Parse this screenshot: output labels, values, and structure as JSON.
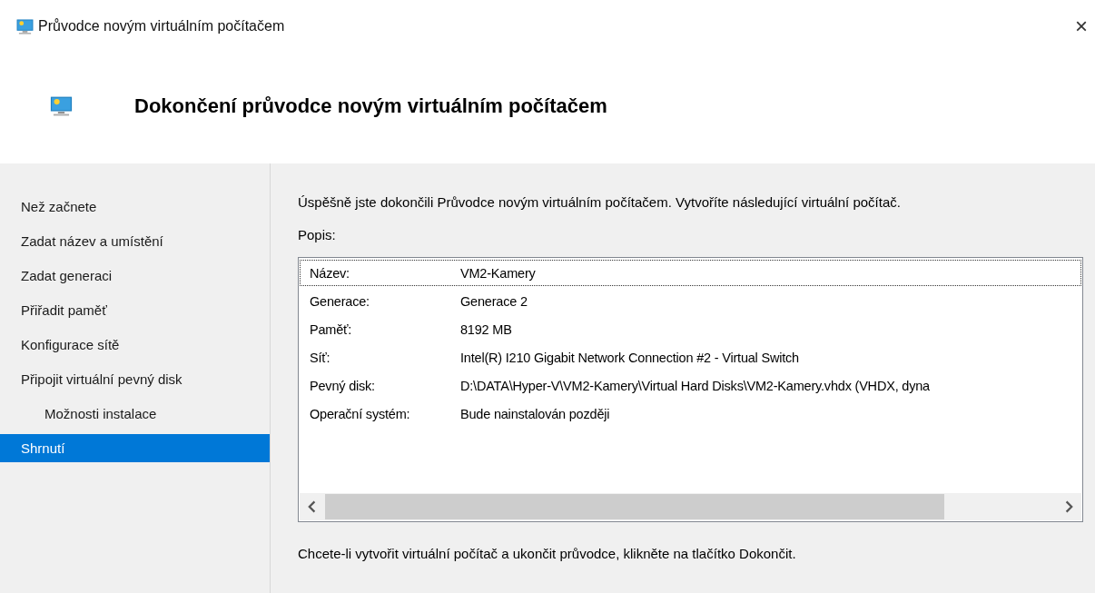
{
  "window": {
    "title": "Průvodce novým virtuálním počítačem",
    "close": "×"
  },
  "header": {
    "title": "Dokončení průvodce novým virtuálním počítačem"
  },
  "sidebar": {
    "items": [
      {
        "label": "Než začnete",
        "selected": false
      },
      {
        "label": "Zadat název a umístění",
        "selected": false
      },
      {
        "label": "Zadat generaci",
        "selected": false
      },
      {
        "label": "Přiřadit paměť",
        "selected": false
      },
      {
        "label": "Konfigurace sítě",
        "selected": false
      },
      {
        "label": "Připojit virtuální pevný disk",
        "selected": false,
        "children": [
          {
            "label": "Možnosti instalace",
            "selected": false
          }
        ]
      },
      {
        "label": "Shrnutí",
        "selected": true
      }
    ]
  },
  "content": {
    "intro": "Úspěšně jste dokončili Průvodce novým virtuálním počítačem. Vytvoříte následující virtuální počítač.",
    "description_label": "Popis:",
    "rows": [
      {
        "label": "Název:",
        "value": "VM2-Kamery",
        "focused": true
      },
      {
        "label": "Generace:",
        "value": "Generace 2",
        "focused": false
      },
      {
        "label": "Paměť:",
        "value": "8192 MB",
        "focused": false
      },
      {
        "label": "Síť:",
        "value": "Intel(R) I210 Gigabit Network Connection #2 - Virtual Switch",
        "focused": false
      },
      {
        "label": "Pevný disk:",
        "value": "D:\\DATA\\Hyper-V\\VM2-Kamery\\Virtual Hard Disks\\VM2-Kamery.vhdx (VHDX, dyna",
        "focused": false
      },
      {
        "label": "Operační systém:",
        "value": "Bude nainstalován později",
        "focused": false
      }
    ],
    "footer": "Chcete-li vytvořit virtuální počítač a ukončit průvodce, klikněte na tlačítko Dokončit."
  }
}
